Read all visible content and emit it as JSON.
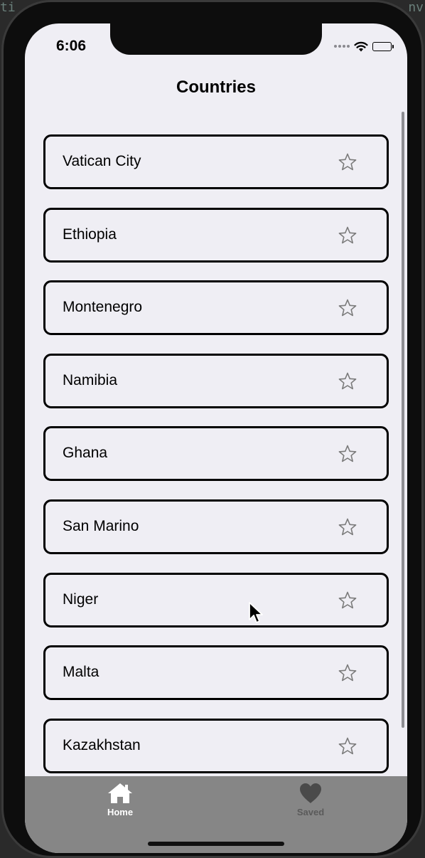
{
  "status_bar": {
    "time": "6:06",
    "icons": [
      "signal-icon",
      "wifi-icon",
      "battery-icon"
    ]
  },
  "nav": {
    "title": "Countries"
  },
  "countries": [
    {
      "name": "Vatican City",
      "icon": "star-outline-icon",
      "favorited": false
    },
    {
      "name": "Ethiopia",
      "icon": "star-outline-icon",
      "favorited": false
    },
    {
      "name": "Montenegro",
      "icon": "star-outline-icon",
      "favorited": false
    },
    {
      "name": "Namibia",
      "icon": "star-outline-icon",
      "favorited": false
    },
    {
      "name": "Ghana",
      "icon": "star-outline-icon",
      "favorited": false
    },
    {
      "name": "San Marino",
      "icon": "star-outline-icon",
      "favorited": false
    },
    {
      "name": "Niger",
      "icon": "star-outline-icon",
      "favorited": false
    },
    {
      "name": "Malta",
      "icon": "star-outline-icon",
      "favorited": false
    },
    {
      "name": "Kazakhstan",
      "icon": "star-outline-icon",
      "favorited": false
    }
  ],
  "tab_bar": {
    "tabs": [
      {
        "label": "Home",
        "icon": "home-icon",
        "selected": true
      },
      {
        "label": "Saved",
        "icon": "heart-icon",
        "selected": false
      }
    ]
  },
  "colors": {
    "screen_background": "#efeef4",
    "row_border": "#000000",
    "tab_bar_background": "#868686",
    "selected_tab": "#ffffff",
    "unselected_tab": "#5a5a5a"
  }
}
